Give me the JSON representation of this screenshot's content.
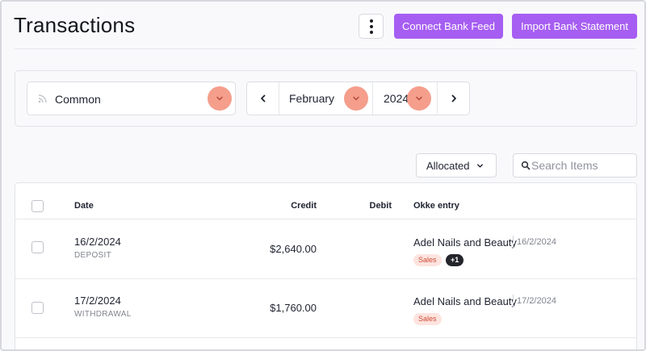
{
  "header": {
    "title": "Transactions",
    "more_icon": "kebab-vertical-icon",
    "connect_label": "Connect Bank Feed",
    "import_label": "Import Bank Statement",
    "accent_color": "#a65ef2"
  },
  "filters": {
    "account": "Common",
    "account_icon": "rss-feed-icon",
    "month": "February",
    "year": "2024",
    "highlight_color": "#f59e8c"
  },
  "toolbar": {
    "status": "Allocated",
    "search_placeholder": "Search Items"
  },
  "table": {
    "columns": {
      "date": "Date",
      "credit": "Credit",
      "debit": "Debit",
      "entry": "Okke entry"
    },
    "rows": [
      {
        "date": "16/2/2024",
        "type": "DEPOSIT",
        "credit": "$2,640.00",
        "debit": "",
        "entry_name": "Adel Nails and Beauty",
        "entry_date": "16/2/2024",
        "tag": "Sales",
        "more": "+1"
      },
      {
        "date": "17/2/2024",
        "type": "WITHDRAWAL",
        "credit": "$1,760.00",
        "debit": "",
        "entry_name": "Adel Nails and Beauty",
        "entry_date": "17/2/2024",
        "tag": "Sales"
      }
    ]
  }
}
